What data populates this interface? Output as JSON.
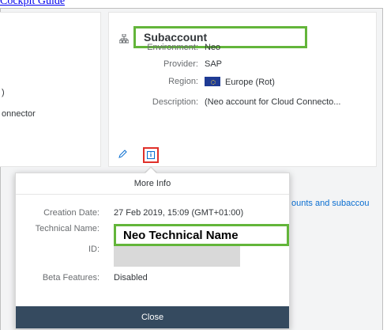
{
  "top_link": "Cockpit Guide",
  "left_card": {
    "fragment1": ")",
    "fragment2": "onnector"
  },
  "subaccount": {
    "title": "Subaccount",
    "rows": [
      {
        "label": "Environment:",
        "value": "Neo"
      },
      {
        "label": "Provider:",
        "value": "SAP"
      },
      {
        "label": "Region:",
        "value": "Europe (Rot)"
      },
      {
        "label": "Description:",
        "value": "(Neo account for Cloud Connecto..."
      }
    ],
    "icons": [
      "hierarchy-icon",
      "pencil-icon",
      "info-icon"
    ]
  },
  "background_link": "ounts and subaccou",
  "popover": {
    "title": "More Info",
    "creation_date": {
      "label": "Creation Date:",
      "value": "27 Feb 2019, 15:09 (GMT+01:00)"
    },
    "technical_name": {
      "label": "Technical Name:",
      "value": "Neo Technical Name"
    },
    "id": {
      "label": "ID:",
      "value": ""
    },
    "beta_features": {
      "label": "Beta Features:",
      "value": "Disabled"
    },
    "close_label": "Close"
  },
  "colors": {
    "highlight_green": "#63b53a",
    "highlight_red": "#e0302a",
    "footer": "#354a5f",
    "link": "#0a6ed1"
  }
}
